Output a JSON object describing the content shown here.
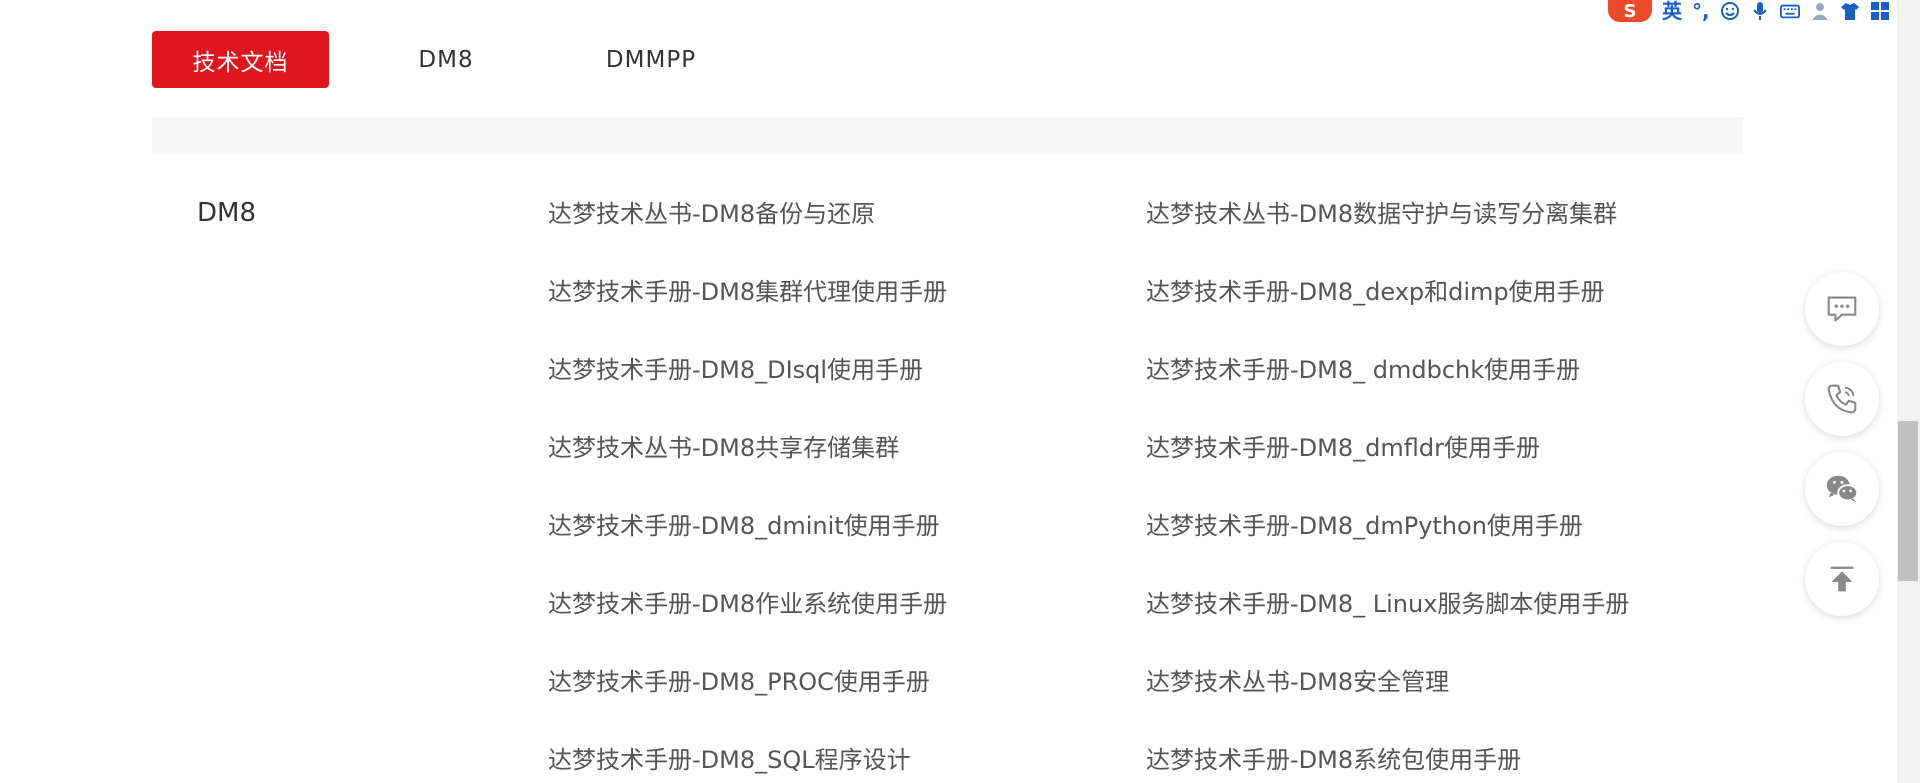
{
  "tabs": [
    {
      "label": "技术文档",
      "active": true
    },
    {
      "label": "DM8",
      "active": false
    },
    {
      "label": "DMMPP",
      "active": false
    }
  ],
  "section": {
    "title": "DM8"
  },
  "links": [
    [
      "达梦技术丛书-DM8备份与还原",
      "达梦技术丛书-DM8数据守护与读写分离集群"
    ],
    [
      "达梦技术手册-DM8集群代理使用手册",
      "达梦技术手册-DM8_dexp和dimp使用手册"
    ],
    [
      "达梦技术手册-DM8_DIsql使用手册",
      "达梦技术手册-DM8_ dmdbchk使用手册"
    ],
    [
      "达梦技术丛书-DM8共享存储集群",
      "达梦技术手册-DM8_dmfldr使用手册"
    ],
    [
      "达梦技术手册-DM8_dminit使用手册",
      "达梦技术手册-DM8_dmPython使用手册"
    ],
    [
      "达梦技术手册-DM8作业系统使用手册",
      "达梦技术手册-DM8_ Linux服务脚本使用手册"
    ],
    [
      "达梦技术手册-DM8_PROC使用手册",
      "达梦技术丛书-DM8安全管理"
    ],
    [
      "达梦技术手册-DM8_SQL程序设计",
      "达梦技术手册-DM8系统包使用手册"
    ]
  ],
  "float_buttons": [
    {
      "icon": "chat-bubble-icon"
    },
    {
      "icon": "phone-icon"
    },
    {
      "icon": "wechat-icon"
    },
    {
      "icon": "back-to-top-icon"
    }
  ],
  "ime": {
    "logo": "S",
    "lang": "英",
    "punct": "°,"
  },
  "colors": {
    "accent": "#e0161e",
    "link": "#555555",
    "ime_blue": "#1a5fc8",
    "ime_logo": "#ee4b2b"
  }
}
